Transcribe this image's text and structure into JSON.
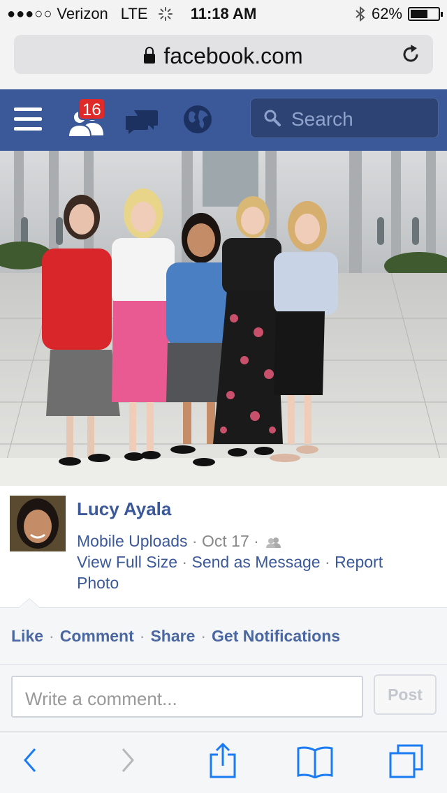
{
  "status_bar": {
    "carrier": "Verizon",
    "network": "LTE",
    "time": "11:18 AM",
    "battery": "62%",
    "battery_level": 0.62
  },
  "address_bar": {
    "url": "facebook.com"
  },
  "fb_nav": {
    "friend_requests_badge": "16",
    "search_placeholder": "Search",
    "brand_color": "#3b5998"
  },
  "post": {
    "author": "Lucy Ayala",
    "album": "Mobile Uploads",
    "date": "Oct 17",
    "links": [
      "View Full Size",
      "Send as Message",
      "Report Photo"
    ]
  },
  "actions": {
    "like": "Like",
    "comment": "Comment",
    "share": "Share",
    "notifications": "Get Notifications"
  },
  "comment_box": {
    "placeholder": "Write a comment...",
    "post_label": "Post"
  },
  "toolbar": {
    "icons": [
      "back-icon",
      "forward-icon",
      "share-icon",
      "bookmarks-icon",
      "tabs-icon"
    ]
  }
}
